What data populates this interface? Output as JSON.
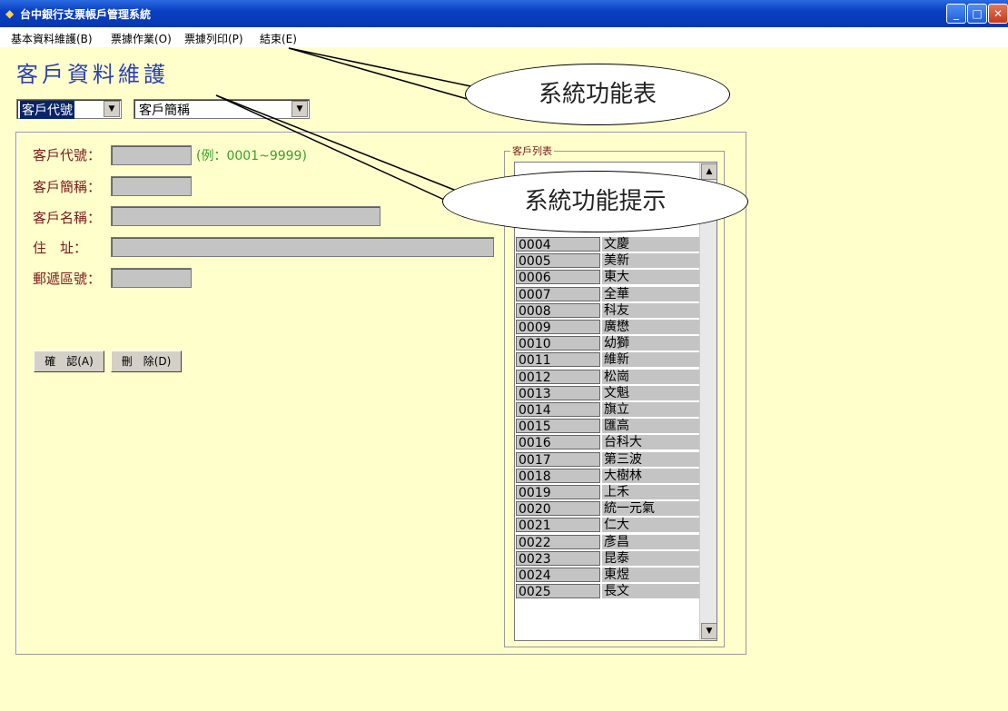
{
  "window": {
    "title": "台中銀行支票帳戶管理系統",
    "buttons": [
      "_",
      "□",
      "✕"
    ]
  },
  "menu": [
    "基本資料維護(B)",
    "票據作業(O)",
    "票據列印(P)",
    "結束(E)"
  ],
  "form": {
    "title": "客戶資料維護",
    "search_field_select": "客戶代號",
    "search_value_select": "客戶簡稱",
    "labels": {
      "code": "客戶代號：",
      "short_name": "客戶簡稱：",
      "full_name": "客戶名稱：",
      "address": "住　址：",
      "zip": "郵遞區號："
    },
    "code_hint": "(例：0001~9999)",
    "confirm_button": "確　認(A)",
    "delete_button": "刪　除(D)"
  },
  "customer_list": {
    "title": "客戶列表",
    "rows": [
      {
        "code": "0004",
        "name": "文慶"
      },
      {
        "code": "0005",
        "name": "美新"
      },
      {
        "code": "0006",
        "name": "東大"
      },
      {
        "code": "0007",
        "name": "全華"
      },
      {
        "code": "0008",
        "name": "科友"
      },
      {
        "code": "0009",
        "name": "廣懋"
      },
      {
        "code": "0010",
        "name": "幼獅"
      },
      {
        "code": "0011",
        "name": "維新"
      },
      {
        "code": "0012",
        "name": "松崗"
      },
      {
        "code": "0013",
        "name": "文魁"
      },
      {
        "code": "0014",
        "name": "旗立"
      },
      {
        "code": "0015",
        "name": "匯高"
      },
      {
        "code": "0016",
        "name": "台科大"
      },
      {
        "code": "0017",
        "name": "第三波"
      },
      {
        "code": "0018",
        "name": "大樹林"
      },
      {
        "code": "0019",
        "name": "上禾"
      },
      {
        "code": "0020",
        "name": "統一元氣"
      },
      {
        "code": "0021",
        "name": "仁大"
      },
      {
        "code": "0022",
        "name": "彥昌"
      },
      {
        "code": "0023",
        "name": "昆泰"
      },
      {
        "code": "0024",
        "name": "東煜"
      },
      {
        "code": "0025",
        "name": "長文"
      }
    ]
  },
  "callouts": {
    "menu": "系統功能表",
    "hint": "系統功能提示"
  }
}
